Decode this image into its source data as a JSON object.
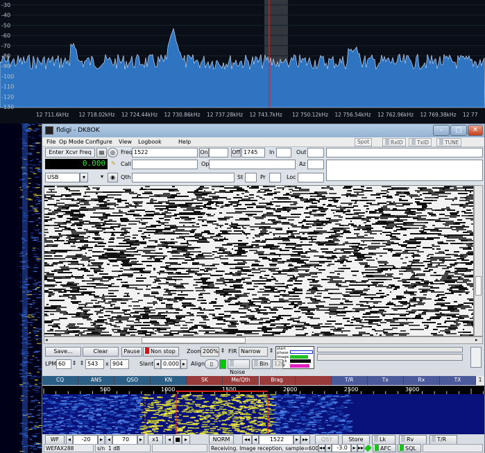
{
  "spectrum": {
    "y_labels": [
      "-30",
      "-40",
      "-50",
      "-60",
      "-70",
      "-80",
      "-90",
      "-100",
      "-110",
      "-120",
      "-130"
    ],
    "x_labels": [
      "12 711.6kHz",
      "12 718.02kHz",
      "12 724.44kHz",
      "12 730.86kHz",
      "12 737.28kHz",
      "12 743.7kHz",
      "12 750.12kHz",
      "12 756.54kHz",
      "12 762.96kHz",
      "12 769.38kHz",
      "12 77"
    ],
    "trace_color": "#2f74c0",
    "marker_color": "#e02020"
  },
  "window": {
    "title": "fldigi - DK8OK"
  },
  "menu": {
    "items": [
      "File",
      "Op Mode",
      "Configure",
      "View",
      "Logbook",
      "Help"
    ],
    "right": [
      "Spot",
      "RxID",
      "TxID",
      "TUNE"
    ]
  },
  "log": {
    "enter_xcvr": "Enter Xcvr Freq",
    "freq_display": "0.000",
    "mode": "USB",
    "freq_label": "Freq",
    "freq_value": "1522",
    "on_label": "On",
    "off_label": "Off",
    "off_value": "1745",
    "in_label": "In",
    "out_label": "Out",
    "call_label": "Call",
    "op_label": "Op",
    "az_label": "Az",
    "qth_label": "Qth",
    "st_label": "St",
    "pr_label": "Pr",
    "loc_label": "Loc"
  },
  "wefax": {
    "save": "Save...",
    "clear": "Clear",
    "pause": "Pause",
    "non_stop": "Non stop",
    "zoom_label": "Zoom",
    "zoom_value": "200%",
    "fir_label": "FIR",
    "fir_value": "Narrow",
    "lpm_label": "LPM",
    "lpm_value": "60",
    "width_value": "543",
    "x_label": "x",
    "height_value": "904",
    "slant_label": "Slant",
    "slant_value": "0.000",
    "align_label": "Align",
    "noise": "Noise",
    "bin": "Bin",
    "bin_value": "128",
    "legend": [
      "start",
      "phase",
      "image",
      "black",
      "stop"
    ],
    "legend_colors": [
      "#1030d0",
      "#ffffff",
      "#20c020",
      "#111111",
      "#e020c0"
    ]
  },
  "macros": [
    {
      "label": "CQ",
      "color": "#2b5f86"
    },
    {
      "label": "ANS",
      "color": "#2b5f86"
    },
    {
      "label": "QSO",
      "color": "#2b5f86"
    },
    {
      "label": "KN",
      "color": "#2b5f86"
    },
    {
      "label": "SK",
      "color": "#9a3b3b"
    },
    {
      "label": "Me/Qth",
      "color": "#9a3b3b"
    },
    {
      "label": "Brag",
      "color": "#9a3b3b"
    },
    {
      "label": "",
      "color": "#9a3b3b"
    },
    {
      "label": "T/R",
      "color": "#4a5a9a"
    },
    {
      "label": "Tx",
      "color": "#4a5a9a"
    },
    {
      "label": "Rx",
      "color": "#4a5a9a"
    },
    {
      "label": "TX",
      "color": "#4a5a9a"
    }
  ],
  "macro_page": "1",
  "scale": {
    "labels": [
      "500",
      "1000",
      "1500",
      "2000",
      "2500",
      "3000"
    ]
  },
  "bottom": {
    "wf": "WF",
    "ref": "-20",
    "range": "70",
    "x1": "x1",
    "norm": "NORM",
    "carrier": "1522",
    "qsy": "QSY",
    "store": "Store",
    "lk": "Lk",
    "rv": "Rv",
    "tr": "T/R"
  },
  "status": {
    "mode": "WEFAX288",
    "sn": "s/n",
    "sn_value": "1 dB",
    "message": "Receiving. Image reception, sample=600000(",
    "offset": "-3.0",
    "afc": "AFC",
    "sql": "SQL"
  }
}
